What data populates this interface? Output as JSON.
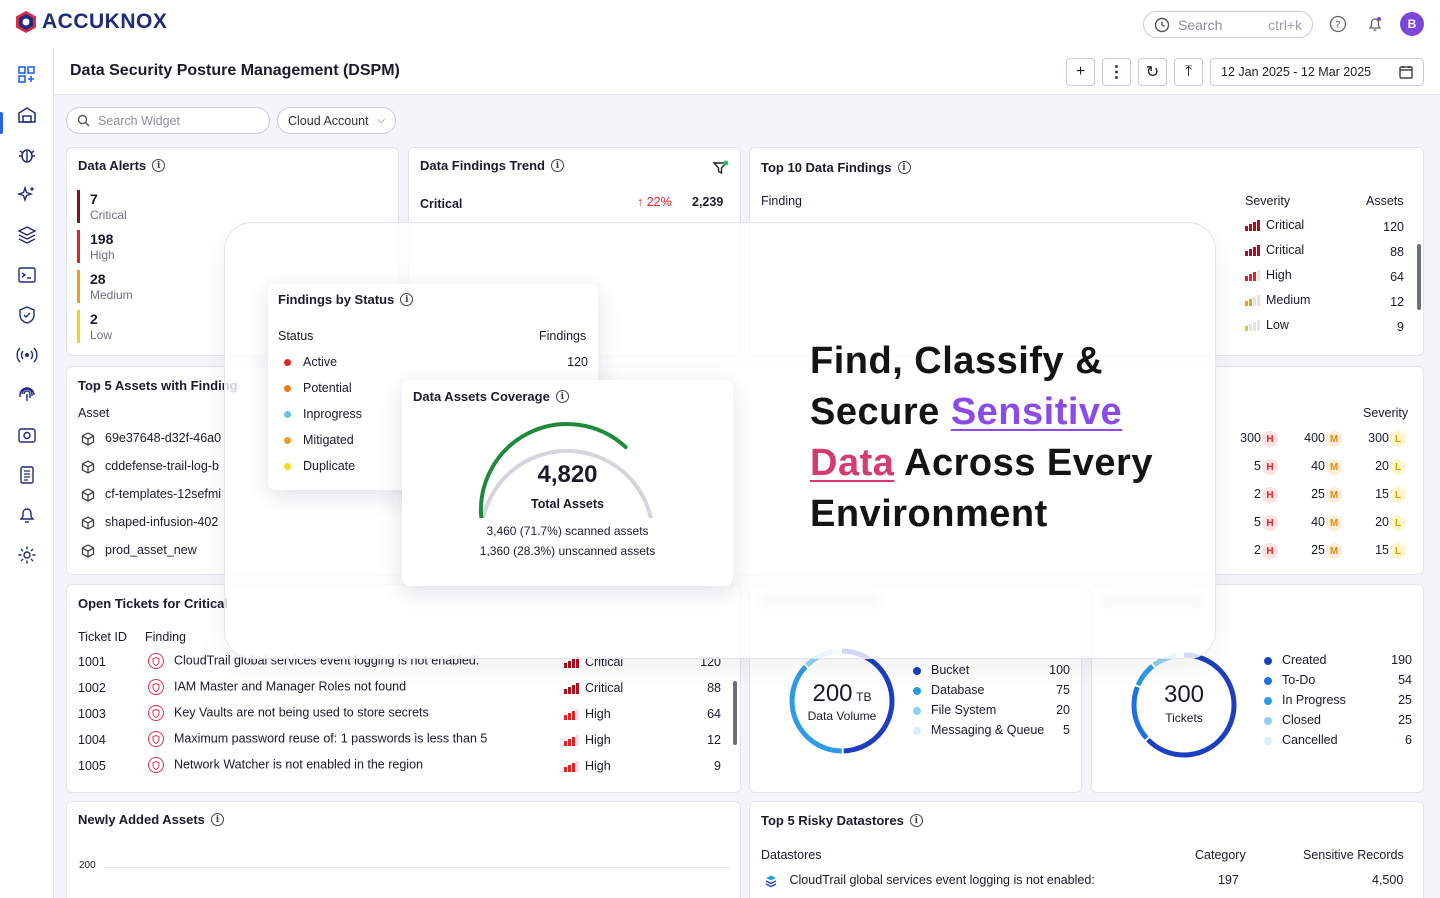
{
  "app": {
    "brand": "ACCUKNOX",
    "avatar_initial": "B"
  },
  "search": {
    "placeholder": "Search",
    "shortcut": "ctrl+k"
  },
  "header": {
    "title": "Data Security Posture Management (DSPM)",
    "date_range": "12 Jan 2025 - 12 Mar 2025"
  },
  "toolbar": {
    "search_widget_placeholder": "Search Widget",
    "cloud_account_label": "Cloud Account"
  },
  "sidebar": {
    "items": [
      "dashboard-icon",
      "inventory-icon",
      "bug-icon",
      "sparkle-icon",
      "layers-icon",
      "terminal-icon",
      "shield-check-icon",
      "broadcast-icon",
      "fingerprint-icon",
      "camera-icon",
      "report-icon",
      "bell-icon",
      "settings-icon"
    ]
  },
  "data_alerts": {
    "title": "Data Alerts",
    "items": [
      {
        "count": "7",
        "label": "Critical",
        "color": "#8b0d1e"
      },
      {
        "count": "198",
        "label": "High",
        "color": "#e02424"
      },
      {
        "count": "28",
        "label": "Medium",
        "color": "#f29a1c"
      },
      {
        "count": "2",
        "label": "Low",
        "color": "#f3d21c"
      }
    ]
  },
  "trend": {
    "title": "Data Findings Trend",
    "severity": "Critical",
    "change": "↑ 22%",
    "total": "2,239"
  },
  "top10": {
    "title": "Top 10 Data Findings",
    "col_finding": "Finding",
    "col_severity": "Severity",
    "col_assets": "Assets",
    "rows": [
      {
        "severity": "Critical",
        "assets": "120",
        "level": 4
      },
      {
        "severity": "Critical",
        "assets": "88",
        "level": 4
      },
      {
        "severity": "High",
        "assets": "64",
        "level": 3
      },
      {
        "severity": "Medium",
        "assets": "12",
        "level": 2
      },
      {
        "severity": "Low",
        "assets": "9",
        "level": 1
      }
    ]
  },
  "top5assets": {
    "title": "Top 5 Assets with Finding",
    "col_asset": "Asset",
    "col_severity": "Severity",
    "rows": [
      {
        "name": "69e37648-d32f-46a0",
        "h": "300",
        "m": "400",
        "l": "300"
      },
      {
        "name": "cddefense-trail-log-b",
        "h": "5",
        "m": "40",
        "l": "20"
      },
      {
        "name": "cf-templates-12sefmi",
        "h": "2",
        "m": "25",
        "l": "15"
      },
      {
        "name": "shaped-infusion-402",
        "h": "5",
        "m": "40",
        "l": "20"
      },
      {
        "name": "prod_asset_new",
        "h": "2",
        "m": "25",
        "l": "15"
      }
    ],
    "badge_h": "H",
    "badge_m": "M",
    "badge_l": "L"
  },
  "findings_by_status": {
    "title": "Findings by Status",
    "col_status": "Status",
    "col_findings": "Findings",
    "rows": [
      {
        "label": "Active",
        "value": "120",
        "color": "#e02424"
      },
      {
        "label": "Potential",
        "value": "",
        "color": "#f07a1a"
      },
      {
        "label": "Inprogress",
        "value": "",
        "color": "#6cc0ee"
      },
      {
        "label": "Mitigated",
        "value": "",
        "color": "#f29a1c"
      },
      {
        "label": "Duplicate",
        "value": "",
        "color": "#f3de1c"
      }
    ]
  },
  "coverage": {
    "title": "Data Assets Coverage",
    "total": "4,820",
    "total_label": "Total Assets",
    "scanned": "3,460 (71.7%) scanned assets",
    "unscanned": "1,360 (28.3%) unscanned assets",
    "scanned_fraction": 0.717
  },
  "headline": {
    "line1": "Find, Classify &",
    "line2a": "Secure ",
    "line2b": "Sensitive",
    "line3a": "Data",
    "line3b": " Across Every",
    "line4": "Environment"
  },
  "tickets": {
    "title": "Open Tickets for Critical",
    "col_id": "Ticket ID",
    "col_finding": "Finding",
    "rows": [
      {
        "id": "1001",
        "finding": "CloudTrail global services event logging is not enabled.",
        "severity": "Critical",
        "count": "120",
        "level": 4
      },
      {
        "id": "1002",
        "finding": "IAM Master and Manager Roles not found",
        "severity": "Critical",
        "count": "88",
        "level": 4
      },
      {
        "id": "1003",
        "finding": "Key Vaults are not being used to store secrets",
        "severity": "High",
        "count": "64",
        "level": 3
      },
      {
        "id": "1004",
        "finding": "Maximum password reuse of: 1 passwords is less than 5",
        "severity": "High",
        "count": "12",
        "level": 3
      },
      {
        "id": "1005",
        "finding": "Network Watcher is not enabled in the region",
        "severity": "High",
        "count": "9",
        "level": 3
      }
    ]
  },
  "data_volume": {
    "value": "200",
    "unit": "TB",
    "label": "Data Volume",
    "legend": [
      {
        "label": "Bucket",
        "value": "100",
        "color": "#1d3fbf"
      },
      {
        "label": "Database",
        "value": "75",
        "color": "#2e9be6"
      },
      {
        "label": "File System",
        "value": "20",
        "color": "#8dd1f5"
      },
      {
        "label": "Messaging & Queue",
        "value": "5",
        "color": "#d7eefc"
      }
    ]
  },
  "tickets_status": {
    "value": "300",
    "label": "Tickets",
    "legend": [
      {
        "label": "Created",
        "value": "190",
        "color": "#1d3fbf"
      },
      {
        "label": "To-Do",
        "value": "54",
        "color": "#1f6fe0"
      },
      {
        "label": "In Progress",
        "value": "25",
        "color": "#2e9be6"
      },
      {
        "label": "Closed",
        "value": "25",
        "color": "#8dd1f5"
      },
      {
        "label": "Cancelled",
        "value": "6",
        "color": "#d7eefc"
      }
    ]
  },
  "newly_added": {
    "title": "Newly Added Assets",
    "y_tick": "200"
  },
  "risky": {
    "title": "Top 5 Risky Datastores",
    "col_ds": "Datastores",
    "col_cat": "Category",
    "col_rec": "Sensitive Records",
    "rows": [
      {
        "name": "CloudTrail global services event logging is not enabled:",
        "category": "197",
        "records": "4,500"
      }
    ]
  }
}
